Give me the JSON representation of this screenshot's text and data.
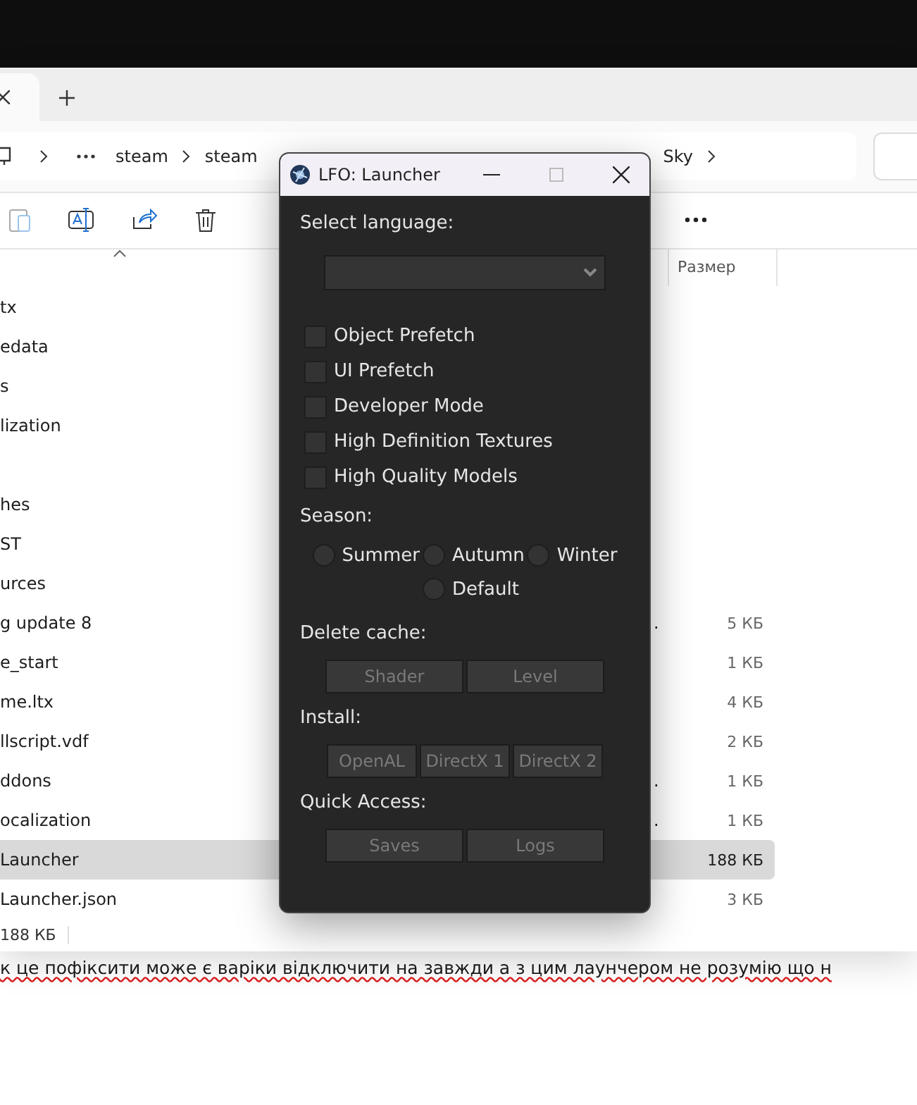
{
  "explorer": {
    "breadcrumbs": [
      "steam",
      "steam",
      "Sky"
    ],
    "column_header": "Размер",
    "files": [
      {
        "name": "tx",
        "selected": false
      },
      {
        "name": "edata",
        "selected": false
      },
      {
        "name": "s",
        "selected": false
      },
      {
        "name": "lization",
        "selected": false
      },
      {
        "selected": false
      },
      {
        "name": "hes",
        "selected": false
      },
      {
        "name": "ST",
        "selected": false
      },
      {
        "name": "urces",
        "selected": false
      },
      {
        "name": "g update 8",
        "column_2": ".",
        "size": "5 КБ",
        "selected": false
      },
      {
        "name": "e_start",
        "size": "1 КБ",
        "selected": false
      },
      {
        "name": "me.ltx",
        "size": "4 КБ",
        "selected": false
      },
      {
        "name": "llscript.vdf",
        "size": "2 КБ",
        "selected": false
      },
      {
        "name": "ddons",
        "column_2": ".",
        "size": "1 КБ",
        "selected": false
      },
      {
        "name": "ocalization",
        "column_2": ".",
        "size": "1 КБ",
        "selected": false
      },
      {
        "name": "Launcher",
        "size": "188 КБ",
        "selected": true
      },
      {
        "name": "Launcher.json",
        "size": "3 КБ",
        "selected": false
      }
    ],
    "status_bar": "188 КБ"
  },
  "message_text": "к це пофіксити може є варіки відключити на завжди а з цим лаунчером не розумію що н",
  "launcher": {
    "title": "LFO: Launcher",
    "language_label": "Select language:",
    "options": [
      {
        "label": "Object Prefetch",
        "checked": false
      },
      {
        "label": "UI Prefetch",
        "checked": false
      },
      {
        "label": "Developer Mode",
        "checked": false
      },
      {
        "label": "High Definition Textures",
        "checked": false
      },
      {
        "label": "High Quality Models",
        "checked": false
      }
    ],
    "season_label": "Season:",
    "seasons": [
      {
        "label": "Summer",
        "selected": false
      },
      {
        "label": "Autumn",
        "selected": false
      },
      {
        "label": "Winter",
        "selected": false
      },
      {
        "label": "Default",
        "selected": false
      }
    ],
    "groups": [
      {
        "label": "Delete cache:",
        "buttons": [
          {
            "label": "Shader",
            "disabled": true
          },
          {
            "label": "Level",
            "disabled": true
          }
        ]
      },
      {
        "label": "Install:",
        "buttons": [
          {
            "label": "OpenAL",
            "disabled": true
          },
          {
            "label": "DirectX 1",
            "disabled": true
          },
          {
            "label": "DirectX 2",
            "disabled": true
          }
        ]
      },
      {
        "label": "Quick Access:",
        "buttons": [
          {
            "label": "Saves",
            "disabled": true
          },
          {
            "label": "Logs",
            "disabled": true
          }
        ]
      }
    ]
  }
}
